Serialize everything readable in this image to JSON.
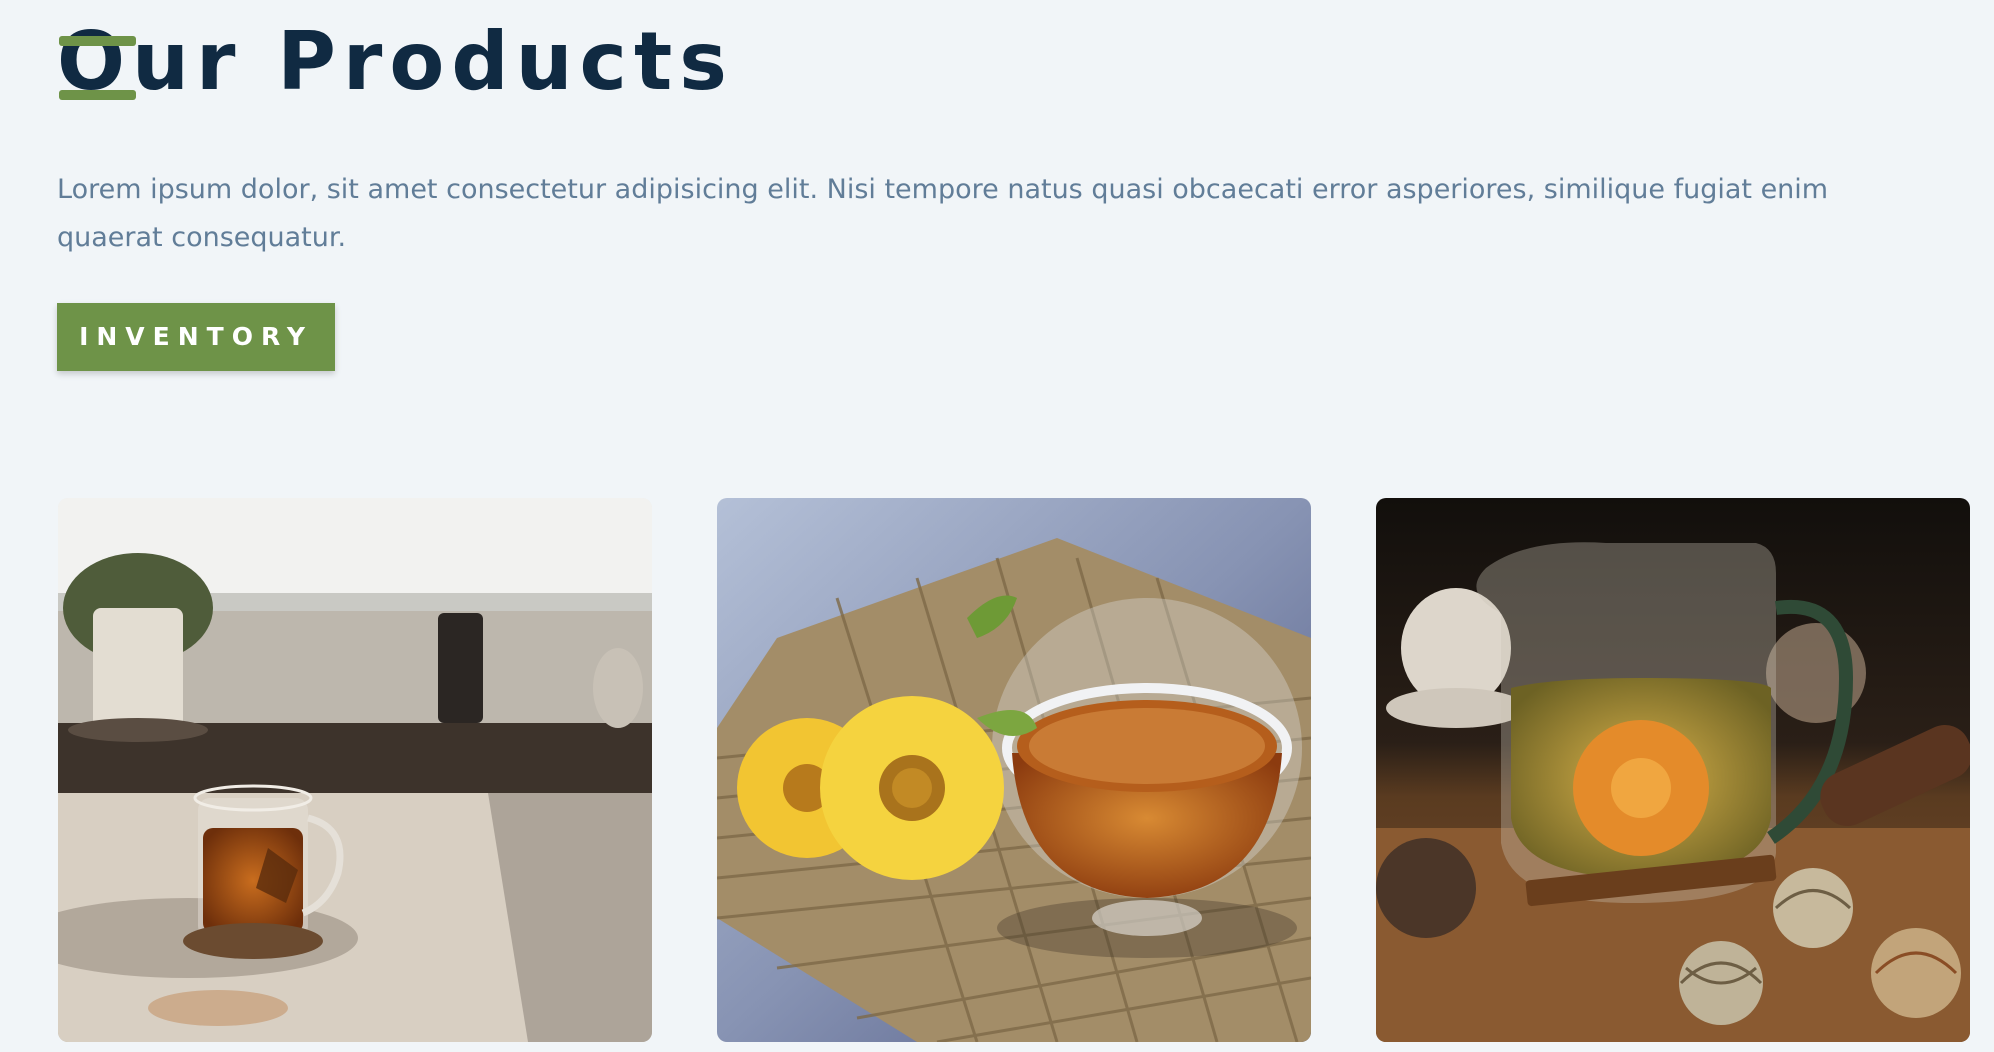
{
  "header": {
    "title": "Our Products"
  },
  "intro": {
    "text": "Lorem ipsum dolor, sit amet consectetur adipisicing elit. Nisi tempore natus quasi obcaecati error asperiores, similique fugiat enim quaerat consequatur."
  },
  "actions": {
    "inventory_label": "INVENTORY"
  },
  "colors": {
    "background": "#f1f5f8",
    "title": "#102a42",
    "text": "#617d98",
    "accent": "#6e9348",
    "button_text": "#ffffff"
  },
  "products": [
    {
      "image": "tea-cup-on-wooden-table-photo"
    },
    {
      "image": "tea-bowl-with-yellow-flowers-photo"
    },
    {
      "image": "glass-teapot-with-blooming-tea-photo"
    }
  ]
}
